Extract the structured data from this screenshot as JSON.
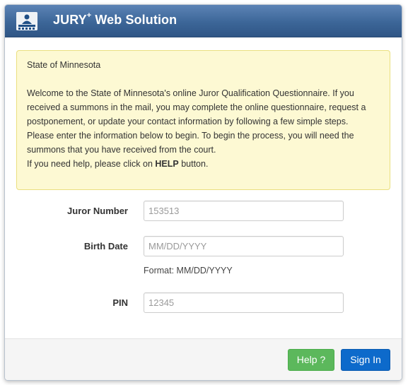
{
  "header": {
    "title_main": "JURY",
    "title_sup": "+",
    "title_rest": " Web Solution"
  },
  "notice": {
    "state": "State of Minnesota",
    "welcome": "Welcome to the State of Minnesota's online Juror Qualification Questionnaire.  If you received a summons in the mail, you may complete the online questionnaire, request a postponement, or update your contact information by following a few simple steps.",
    "instructions": "Please enter the information below to begin. To begin the process, you will need the summons that you have received from the court.",
    "help_prefix": "If you need help, please click on ",
    "help_strong": "HELP",
    "help_suffix": " button."
  },
  "form": {
    "juror_number_label": "Juror Number",
    "juror_number_placeholder": "153513",
    "birth_date_label": "Birth Date",
    "birth_date_placeholder": "MM/DD/YYYY",
    "birth_date_hint": "Format: MM/DD/YYYY",
    "pin_label": "PIN",
    "pin_placeholder": "12345"
  },
  "footer": {
    "help_label": "Help ?",
    "signin_label": "Sign In"
  },
  "colors": {
    "header": "#3c6698",
    "notice_bg": "#fdf9d3",
    "help_button": "#5cb85c",
    "signin_button": "#0d6acb"
  },
  "icons": {
    "logo": "jury-logo-icon"
  }
}
